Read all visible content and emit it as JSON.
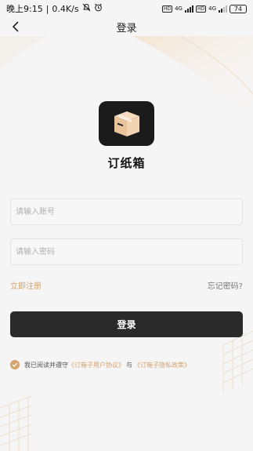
{
  "status_bar": {
    "time": "晚上9:15",
    "separator": "|",
    "speed": "0.4K/s",
    "battery": "74",
    "hd1": "HD",
    "net1": "4G",
    "hd2": "HD",
    "net2": "4G"
  },
  "nav": {
    "title": "登录",
    "back_icon": "chevron-left-icon"
  },
  "app": {
    "name": "订纸箱",
    "logo_icon": "box-icon"
  },
  "form": {
    "account_placeholder": "请输入账号",
    "account_value": "",
    "password_placeholder": "请输入密码",
    "password_value": "",
    "register_label": "立即注册",
    "forgot_label": "忘记密码?",
    "login_label": "登录"
  },
  "agreement": {
    "checked": true,
    "prefix": "我已阅读并遵守",
    "user_agreement": "《订箱子用户协议》",
    "and": "与",
    "privacy_policy": "《订箱子隐私政策》"
  },
  "colors": {
    "accent": "#d4a36c",
    "button": "#2a2a2a",
    "background": "#f6f5f5"
  }
}
